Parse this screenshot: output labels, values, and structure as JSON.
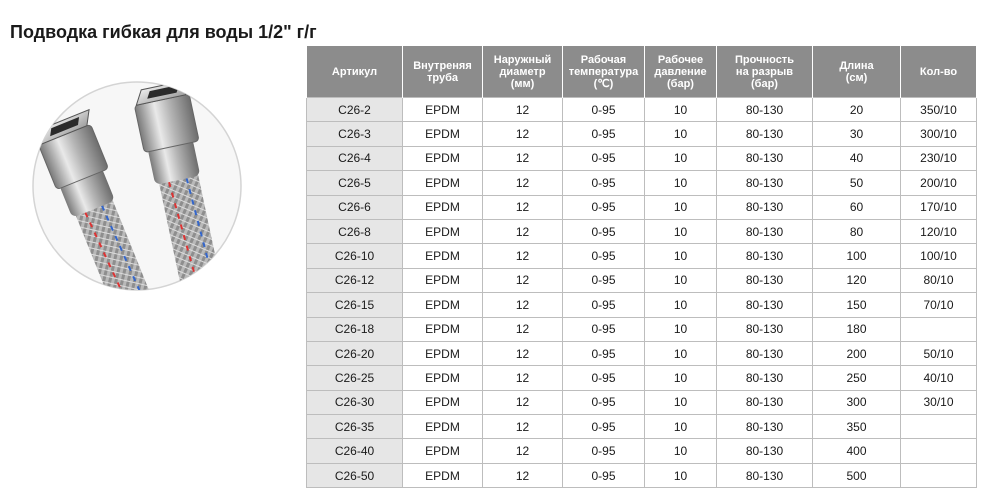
{
  "title": "Подводка гибкая для воды 1/2\" г/г",
  "table": {
    "headers": [
      {
        "lines": [
          "Артикул"
        ]
      },
      {
        "lines": [
          "Внутреняя",
          "труба"
        ]
      },
      {
        "lines": [
          "Наружный",
          "диаметр",
          "(мм)"
        ]
      },
      {
        "lines": [
          "Рабочая",
          "температура",
          "(℃)"
        ]
      },
      {
        "lines": [
          "Рабочее",
          "давление",
          "(бар)"
        ]
      },
      {
        "lines": [
          "Прочность",
          "на разрыв",
          "(бар)"
        ]
      },
      {
        "lines": [
          "Длина",
          "(см)"
        ]
      },
      {
        "lines": [
          "Кол-во"
        ]
      }
    ],
    "rows": [
      [
        "C26-2",
        "EPDM",
        "12",
        "0-95",
        "10",
        "80-130",
        "20",
        "350/10"
      ],
      [
        "C26-3",
        "EPDM",
        "12",
        "0-95",
        "10",
        "80-130",
        "30",
        "300/10"
      ],
      [
        "C26-4",
        "EPDM",
        "12",
        "0-95",
        "10",
        "80-130",
        "40",
        "230/10"
      ],
      [
        "C26-5",
        "EPDM",
        "12",
        "0-95",
        "10",
        "80-130",
        "50",
        "200/10"
      ],
      [
        "C26-6",
        "EPDM",
        "12",
        "0-95",
        "10",
        "80-130",
        "60",
        "170/10"
      ],
      [
        "C26-8",
        "EPDM",
        "12",
        "0-95",
        "10",
        "80-130",
        "80",
        "120/10"
      ],
      [
        "C26-10",
        "EPDM",
        "12",
        "0-95",
        "10",
        "80-130",
        "100",
        "100/10"
      ],
      [
        "C26-12",
        "EPDM",
        "12",
        "0-95",
        "10",
        "80-130",
        "120",
        "80/10"
      ],
      [
        "C26-15",
        "EPDM",
        "12",
        "0-95",
        "10",
        "80-130",
        "150",
        "70/10"
      ],
      [
        "C26-18",
        "EPDM",
        "12",
        "0-95",
        "10",
        "80-130",
        "180",
        ""
      ],
      [
        "C26-20",
        "EPDM",
        "12",
        "0-95",
        "10",
        "80-130",
        "200",
        "50/10"
      ],
      [
        "C26-25",
        "EPDM",
        "12",
        "0-95",
        "10",
        "80-130",
        "250",
        "40/10"
      ],
      [
        "C26-30",
        "EPDM",
        "12",
        "0-95",
        "10",
        "80-130",
        "300",
        "30/10"
      ],
      [
        "C26-35",
        "EPDM",
        "12",
        "0-95",
        "10",
        "80-130",
        "350",
        ""
      ],
      [
        "C26-40",
        "EPDM",
        "12",
        "0-95",
        "10",
        "80-130",
        "400",
        ""
      ],
      [
        "C26-50",
        "EPDM",
        "12",
        "0-95",
        "10",
        "80-130",
        "500",
        ""
      ]
    ]
  },
  "colors": {
    "header_bg": "#8c8c8c",
    "header_text": "#ffffff",
    "article_col_bg": "#e6e6e6",
    "grid_line": "#bdbdbd",
    "title_text": "#1a1a1a"
  },
  "icons": {
    "product_photo": "braided-hose-icon"
  }
}
